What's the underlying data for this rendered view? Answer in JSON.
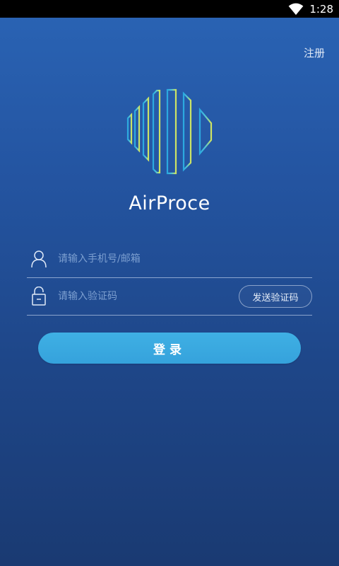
{
  "status_bar": {
    "time": "1:28",
    "icons": [
      "wifi-icon"
    ]
  },
  "header": {
    "register_label": "注册"
  },
  "brand": {
    "app_name": "AirProce",
    "logo_colors": [
      "#2aa8e0",
      "#34b7e6",
      "#46c0df",
      "#58c6cc",
      "#6fcdb4",
      "#8fd69a",
      "#b3df7a",
      "#d4e55e"
    ]
  },
  "form": {
    "phone": {
      "icon": "user-icon",
      "value": "",
      "placeholder": "请输入手机号/邮箱"
    },
    "code": {
      "icon": "lock-icon",
      "value": "",
      "placeholder": "请输入验证码",
      "send_code_label": "发送验证码"
    },
    "login_label": "登录"
  },
  "colors": {
    "background_top": "#2a64b5",
    "background_bottom": "#1a3a72",
    "login_button": "#3aa9e0",
    "placeholder": "#7c9fd0"
  }
}
